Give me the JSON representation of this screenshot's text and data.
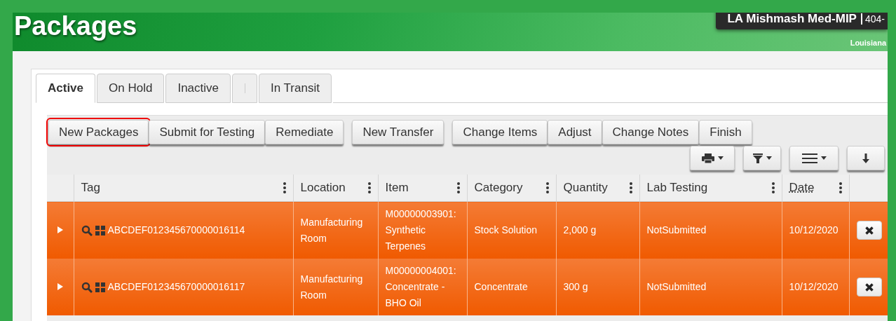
{
  "header": {
    "title": "Packages",
    "facility": "LA Mishmash Med-MIP",
    "license": "404-",
    "state": "Louisiana"
  },
  "tabs": [
    {
      "kind": "tab",
      "label": "Active",
      "selected": true
    },
    {
      "kind": "tab",
      "label": "On Hold",
      "selected": false
    },
    {
      "kind": "tab",
      "label": "Inactive",
      "selected": false
    },
    {
      "kind": "separator"
    },
    {
      "kind": "tab",
      "label": "In Transit",
      "selected": false
    }
  ],
  "action_groups": [
    [
      {
        "label": "New Packages",
        "highlighted": true
      },
      {
        "label": "Submit for Testing",
        "highlighted": false
      },
      {
        "label": "Remediate",
        "highlighted": false
      }
    ],
    [
      {
        "label": "New Transfer",
        "highlighted": false
      }
    ],
    [
      {
        "label": "Change Items",
        "highlighted": false
      },
      {
        "label": "Adjust",
        "highlighted": false
      },
      {
        "label": "Change Notes",
        "highlighted": false
      },
      {
        "label": "Finish",
        "highlighted": false
      }
    ]
  ],
  "tool_buttons": [
    {
      "kind": "print",
      "dropdown": true
    },
    {
      "kind": "filter",
      "dropdown": true
    },
    {
      "kind": "columns",
      "dropdown": true
    },
    {
      "kind": "download",
      "dropdown": false
    }
  ],
  "table": {
    "columns": [
      {
        "label": "Tag",
        "abbr": false
      },
      {
        "label": "Location",
        "abbr": false
      },
      {
        "label": "Item",
        "abbr": false
      },
      {
        "label": "Category",
        "abbr": false
      },
      {
        "label": "Quantity",
        "abbr": false
      },
      {
        "label": "Lab Testing",
        "abbr": false
      },
      {
        "label": "Date",
        "abbr": true
      }
    ],
    "rows": [
      {
        "expanded": false,
        "cells": [
          "ABCDEF012345670000016114",
          "Manufacturing Room",
          "M00000003901: Synthetic Terpenes",
          "Stock Solution",
          "2,000 g",
          "NotSubmitted",
          "10/12/2020"
        ]
      },
      {
        "expanded": false,
        "cells": [
          "ABCDEF012345670000016117",
          "Manufacturing Room",
          "M00000004001: Concentrate - BHO Oil",
          "Concentrate",
          "300 g",
          "NotSubmitted",
          "10/12/2020"
        ]
      }
    ]
  }
}
